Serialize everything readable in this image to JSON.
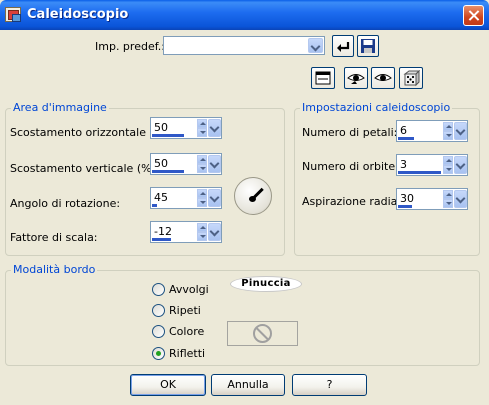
{
  "window": {
    "title": "Caleidoscopio"
  },
  "preset": {
    "label": "Imp. predef.:",
    "value": ""
  },
  "toolbar_icons": [
    "reset-defaults-icon",
    "save-preset-icon",
    "proof-toggle-icon",
    "eye-preview-icon",
    "eye-icon",
    "randomize-dice-icon"
  ],
  "image_area": {
    "title": "Area d'immagine",
    "fields": [
      {
        "label": "Scostamento orizzontale (%):",
        "value": "50",
        "fill": 0.75
      },
      {
        "label": "Scostamento verticale (%):",
        "value": "50",
        "fill": 0.75
      },
      {
        "label": "Angolo di rotazione:",
        "value": "45",
        "fill": 0.12
      },
      {
        "label": "Fattore di scala:",
        "value": "-12",
        "fill": 0.44
      }
    ]
  },
  "kaleidoscope": {
    "title": "Impostazioni caleidoscopio",
    "fields": [
      {
        "label": "Numero di petali:",
        "value": "6",
        "fill": 0.37
      },
      {
        "label": "Numero di orbite:",
        "value": "3",
        "fill": 1.0
      },
      {
        "label": "Aspirazione radiale:",
        "value": "30",
        "fill": 0.32
      }
    ]
  },
  "edge_mode": {
    "title": "Modalità bordo",
    "options": [
      {
        "label": "Avvolgi",
        "selected": false
      },
      {
        "label": "Ripeti",
        "selected": false
      },
      {
        "label": "Colore",
        "selected": false
      },
      {
        "label": "Rifletti",
        "selected": true
      }
    ],
    "logo_text": "Pinuccia"
  },
  "buttons": {
    "ok": "OK",
    "cancel": "Annulla",
    "help": "?"
  },
  "colors": {
    "accent": "#0046d5",
    "titlebar": "#0a54d8",
    "progress": "#2f58c7"
  }
}
